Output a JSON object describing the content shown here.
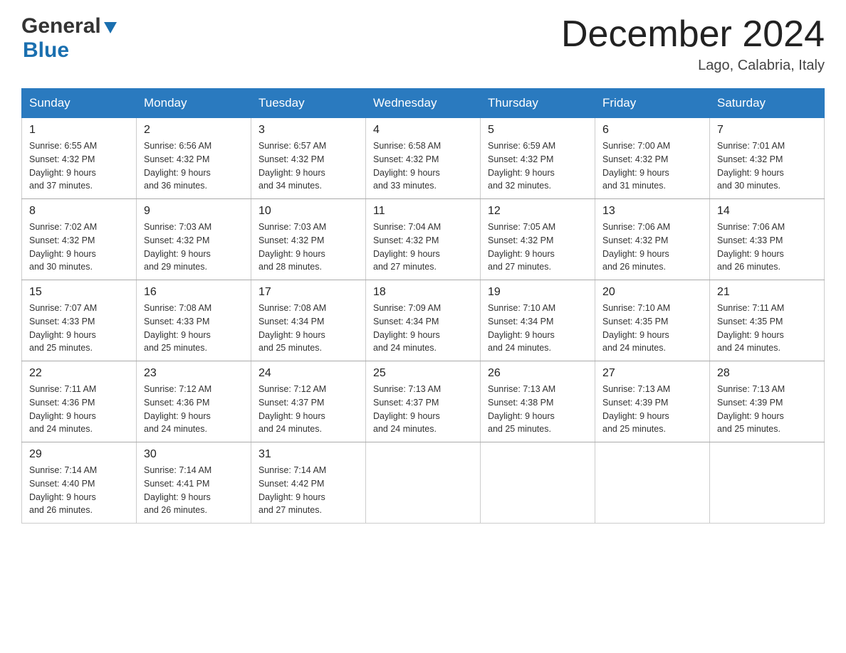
{
  "header": {
    "logo_general": "General",
    "logo_blue": "Blue",
    "month_title": "December 2024",
    "location": "Lago, Calabria, Italy"
  },
  "weekdays": [
    "Sunday",
    "Monday",
    "Tuesday",
    "Wednesday",
    "Thursday",
    "Friday",
    "Saturday"
  ],
  "weeks": [
    [
      {
        "day": "1",
        "sunrise": "6:55 AM",
        "sunset": "4:32 PM",
        "daylight": "9 hours and 37 minutes."
      },
      {
        "day": "2",
        "sunrise": "6:56 AM",
        "sunset": "4:32 PM",
        "daylight": "9 hours and 36 minutes."
      },
      {
        "day": "3",
        "sunrise": "6:57 AM",
        "sunset": "4:32 PM",
        "daylight": "9 hours and 34 minutes."
      },
      {
        "day": "4",
        "sunrise": "6:58 AM",
        "sunset": "4:32 PM",
        "daylight": "9 hours and 33 minutes."
      },
      {
        "day": "5",
        "sunrise": "6:59 AM",
        "sunset": "4:32 PM",
        "daylight": "9 hours and 32 minutes."
      },
      {
        "day": "6",
        "sunrise": "7:00 AM",
        "sunset": "4:32 PM",
        "daylight": "9 hours and 31 minutes."
      },
      {
        "day": "7",
        "sunrise": "7:01 AM",
        "sunset": "4:32 PM",
        "daylight": "9 hours and 30 minutes."
      }
    ],
    [
      {
        "day": "8",
        "sunrise": "7:02 AM",
        "sunset": "4:32 PM",
        "daylight": "9 hours and 30 minutes."
      },
      {
        "day": "9",
        "sunrise": "7:03 AM",
        "sunset": "4:32 PM",
        "daylight": "9 hours and 29 minutes."
      },
      {
        "day": "10",
        "sunrise": "7:03 AM",
        "sunset": "4:32 PM",
        "daylight": "9 hours and 28 minutes."
      },
      {
        "day": "11",
        "sunrise": "7:04 AM",
        "sunset": "4:32 PM",
        "daylight": "9 hours and 27 minutes."
      },
      {
        "day": "12",
        "sunrise": "7:05 AM",
        "sunset": "4:32 PM",
        "daylight": "9 hours and 27 minutes."
      },
      {
        "day": "13",
        "sunrise": "7:06 AM",
        "sunset": "4:32 PM",
        "daylight": "9 hours and 26 minutes."
      },
      {
        "day": "14",
        "sunrise": "7:06 AM",
        "sunset": "4:33 PM",
        "daylight": "9 hours and 26 minutes."
      }
    ],
    [
      {
        "day": "15",
        "sunrise": "7:07 AM",
        "sunset": "4:33 PM",
        "daylight": "9 hours and 25 minutes."
      },
      {
        "day": "16",
        "sunrise": "7:08 AM",
        "sunset": "4:33 PM",
        "daylight": "9 hours and 25 minutes."
      },
      {
        "day": "17",
        "sunrise": "7:08 AM",
        "sunset": "4:34 PM",
        "daylight": "9 hours and 25 minutes."
      },
      {
        "day": "18",
        "sunrise": "7:09 AM",
        "sunset": "4:34 PM",
        "daylight": "9 hours and 24 minutes."
      },
      {
        "day": "19",
        "sunrise": "7:10 AM",
        "sunset": "4:34 PM",
        "daylight": "9 hours and 24 minutes."
      },
      {
        "day": "20",
        "sunrise": "7:10 AM",
        "sunset": "4:35 PM",
        "daylight": "9 hours and 24 minutes."
      },
      {
        "day": "21",
        "sunrise": "7:11 AM",
        "sunset": "4:35 PM",
        "daylight": "9 hours and 24 minutes."
      }
    ],
    [
      {
        "day": "22",
        "sunrise": "7:11 AM",
        "sunset": "4:36 PM",
        "daylight": "9 hours and 24 minutes."
      },
      {
        "day": "23",
        "sunrise": "7:12 AM",
        "sunset": "4:36 PM",
        "daylight": "9 hours and 24 minutes."
      },
      {
        "day": "24",
        "sunrise": "7:12 AM",
        "sunset": "4:37 PM",
        "daylight": "9 hours and 24 minutes."
      },
      {
        "day": "25",
        "sunrise": "7:13 AM",
        "sunset": "4:37 PM",
        "daylight": "9 hours and 24 minutes."
      },
      {
        "day": "26",
        "sunrise": "7:13 AM",
        "sunset": "4:38 PM",
        "daylight": "9 hours and 25 minutes."
      },
      {
        "day": "27",
        "sunrise": "7:13 AM",
        "sunset": "4:39 PM",
        "daylight": "9 hours and 25 minutes."
      },
      {
        "day": "28",
        "sunrise": "7:13 AM",
        "sunset": "4:39 PM",
        "daylight": "9 hours and 25 minutes."
      }
    ],
    [
      {
        "day": "29",
        "sunrise": "7:14 AM",
        "sunset": "4:40 PM",
        "daylight": "9 hours and 26 minutes."
      },
      {
        "day": "30",
        "sunrise": "7:14 AM",
        "sunset": "4:41 PM",
        "daylight": "9 hours and 26 minutes."
      },
      {
        "day": "31",
        "sunrise": "7:14 AM",
        "sunset": "4:42 PM",
        "daylight": "9 hours and 27 minutes."
      },
      null,
      null,
      null,
      null
    ]
  ],
  "labels": {
    "sunrise": "Sunrise:",
    "sunset": "Sunset:",
    "daylight": "Daylight:"
  }
}
